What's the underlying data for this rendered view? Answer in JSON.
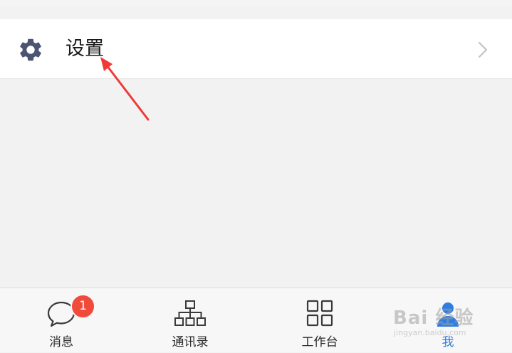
{
  "settings": {
    "label": "设置",
    "icon": "gear-icon",
    "chevron": "chevron-right-icon"
  },
  "tabbar": {
    "items": [
      {
        "label": "消息",
        "icon": "chat-bubble-icon",
        "badge": "1",
        "active": false
      },
      {
        "label": "通讯录",
        "icon": "org-chart-icon",
        "active": false
      },
      {
        "label": "工作台",
        "icon": "grid-icon",
        "active": false
      },
      {
        "label": "我",
        "icon": "user-icon",
        "active": true
      }
    ]
  },
  "watermark": {
    "text": "Bai 经验",
    "sub": "jingyan.baidu.com"
  },
  "colors": {
    "accent": "#2f7de0",
    "badge": "#f04b3a",
    "arrow": "#f03a3a",
    "gear": "#4b5572"
  }
}
